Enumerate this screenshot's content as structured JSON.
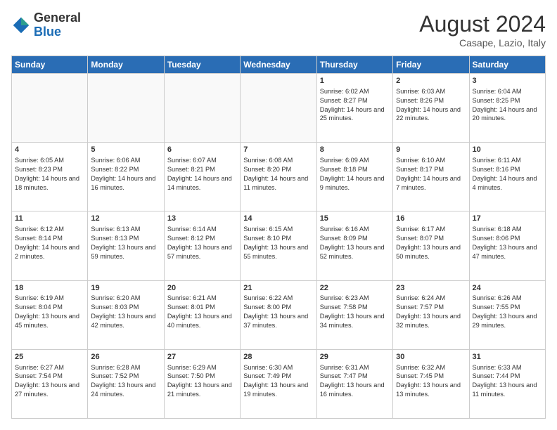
{
  "logo": {
    "general": "General",
    "blue": "Blue"
  },
  "title": "August 2024",
  "subtitle": "Casape, Lazio, Italy",
  "days_header": [
    "Sunday",
    "Monday",
    "Tuesday",
    "Wednesday",
    "Thursday",
    "Friday",
    "Saturday"
  ],
  "weeks": [
    [
      {
        "day": "",
        "info": ""
      },
      {
        "day": "",
        "info": ""
      },
      {
        "day": "",
        "info": ""
      },
      {
        "day": "",
        "info": ""
      },
      {
        "day": "1",
        "info": "Sunrise: 6:02 AM\nSunset: 8:27 PM\nDaylight: 14 hours and 25 minutes."
      },
      {
        "day": "2",
        "info": "Sunrise: 6:03 AM\nSunset: 8:26 PM\nDaylight: 14 hours and 22 minutes."
      },
      {
        "day": "3",
        "info": "Sunrise: 6:04 AM\nSunset: 8:25 PM\nDaylight: 14 hours and 20 minutes."
      }
    ],
    [
      {
        "day": "4",
        "info": "Sunrise: 6:05 AM\nSunset: 8:23 PM\nDaylight: 14 hours and 18 minutes."
      },
      {
        "day": "5",
        "info": "Sunrise: 6:06 AM\nSunset: 8:22 PM\nDaylight: 14 hours and 16 minutes."
      },
      {
        "day": "6",
        "info": "Sunrise: 6:07 AM\nSunset: 8:21 PM\nDaylight: 14 hours and 14 minutes."
      },
      {
        "day": "7",
        "info": "Sunrise: 6:08 AM\nSunset: 8:20 PM\nDaylight: 14 hours and 11 minutes."
      },
      {
        "day": "8",
        "info": "Sunrise: 6:09 AM\nSunset: 8:18 PM\nDaylight: 14 hours and 9 minutes."
      },
      {
        "day": "9",
        "info": "Sunrise: 6:10 AM\nSunset: 8:17 PM\nDaylight: 14 hours and 7 minutes."
      },
      {
        "day": "10",
        "info": "Sunrise: 6:11 AM\nSunset: 8:16 PM\nDaylight: 14 hours and 4 minutes."
      }
    ],
    [
      {
        "day": "11",
        "info": "Sunrise: 6:12 AM\nSunset: 8:14 PM\nDaylight: 14 hours and 2 minutes."
      },
      {
        "day": "12",
        "info": "Sunrise: 6:13 AM\nSunset: 8:13 PM\nDaylight: 13 hours and 59 minutes."
      },
      {
        "day": "13",
        "info": "Sunrise: 6:14 AM\nSunset: 8:12 PM\nDaylight: 13 hours and 57 minutes."
      },
      {
        "day": "14",
        "info": "Sunrise: 6:15 AM\nSunset: 8:10 PM\nDaylight: 13 hours and 55 minutes."
      },
      {
        "day": "15",
        "info": "Sunrise: 6:16 AM\nSunset: 8:09 PM\nDaylight: 13 hours and 52 minutes."
      },
      {
        "day": "16",
        "info": "Sunrise: 6:17 AM\nSunset: 8:07 PM\nDaylight: 13 hours and 50 minutes."
      },
      {
        "day": "17",
        "info": "Sunrise: 6:18 AM\nSunset: 8:06 PM\nDaylight: 13 hours and 47 minutes."
      }
    ],
    [
      {
        "day": "18",
        "info": "Sunrise: 6:19 AM\nSunset: 8:04 PM\nDaylight: 13 hours and 45 minutes."
      },
      {
        "day": "19",
        "info": "Sunrise: 6:20 AM\nSunset: 8:03 PM\nDaylight: 13 hours and 42 minutes."
      },
      {
        "day": "20",
        "info": "Sunrise: 6:21 AM\nSunset: 8:01 PM\nDaylight: 13 hours and 40 minutes."
      },
      {
        "day": "21",
        "info": "Sunrise: 6:22 AM\nSunset: 8:00 PM\nDaylight: 13 hours and 37 minutes."
      },
      {
        "day": "22",
        "info": "Sunrise: 6:23 AM\nSunset: 7:58 PM\nDaylight: 13 hours and 34 minutes."
      },
      {
        "day": "23",
        "info": "Sunrise: 6:24 AM\nSunset: 7:57 PM\nDaylight: 13 hours and 32 minutes."
      },
      {
        "day": "24",
        "info": "Sunrise: 6:26 AM\nSunset: 7:55 PM\nDaylight: 13 hours and 29 minutes."
      }
    ],
    [
      {
        "day": "25",
        "info": "Sunrise: 6:27 AM\nSunset: 7:54 PM\nDaylight: 13 hours and 27 minutes."
      },
      {
        "day": "26",
        "info": "Sunrise: 6:28 AM\nSunset: 7:52 PM\nDaylight: 13 hours and 24 minutes."
      },
      {
        "day": "27",
        "info": "Sunrise: 6:29 AM\nSunset: 7:50 PM\nDaylight: 13 hours and 21 minutes."
      },
      {
        "day": "28",
        "info": "Sunrise: 6:30 AM\nSunset: 7:49 PM\nDaylight: 13 hours and 19 minutes."
      },
      {
        "day": "29",
        "info": "Sunrise: 6:31 AM\nSunset: 7:47 PM\nDaylight: 13 hours and 16 minutes."
      },
      {
        "day": "30",
        "info": "Sunrise: 6:32 AM\nSunset: 7:45 PM\nDaylight: 13 hours and 13 minutes."
      },
      {
        "day": "31",
        "info": "Sunrise: 6:33 AM\nSunset: 7:44 PM\nDaylight: 13 hours and 11 minutes."
      }
    ]
  ]
}
